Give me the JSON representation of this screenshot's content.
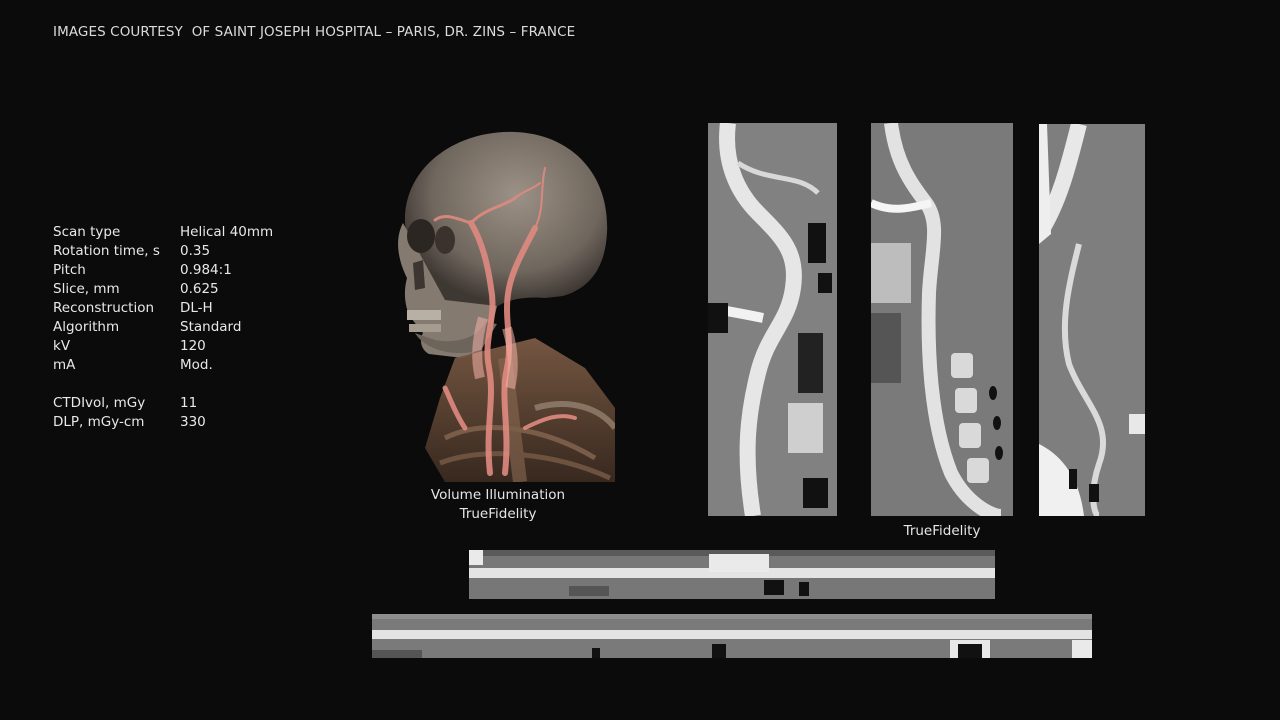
{
  "courtesy": {
    "part1": "IMAGES COURTESY",
    "part2": "OF SAINT JOSEPH HOSPITAL – PARIS, DR. ZINS – FRANCE"
  },
  "scan_params": {
    "rows": [
      {
        "label": "Scan type",
        "value": "Helical 40mm"
      },
      {
        "label": "Rotation time, s",
        "value": "0.35"
      },
      {
        "label": "Pitch",
        "value": "0.984:1"
      },
      {
        "label": "Slice, mm",
        "value": "0.625"
      },
      {
        "label": "Reconstruction",
        "value": "DL-H"
      },
      {
        "label": "Algorithm",
        "value": "Standard"
      },
      {
        "label": "kV",
        "value": "120"
      },
      {
        "label": "mA",
        "value": "Mod."
      }
    ],
    "dose_rows": [
      {
        "label": "CTDIvol, mGy",
        "value": "11"
      },
      {
        "label": "DLP, mGy-cm",
        "value": "330"
      }
    ]
  },
  "captions": {
    "volume_line1": "Volume Illumination",
    "volume_line2": "TrueFidelity",
    "slices": "TrueFidelity"
  }
}
